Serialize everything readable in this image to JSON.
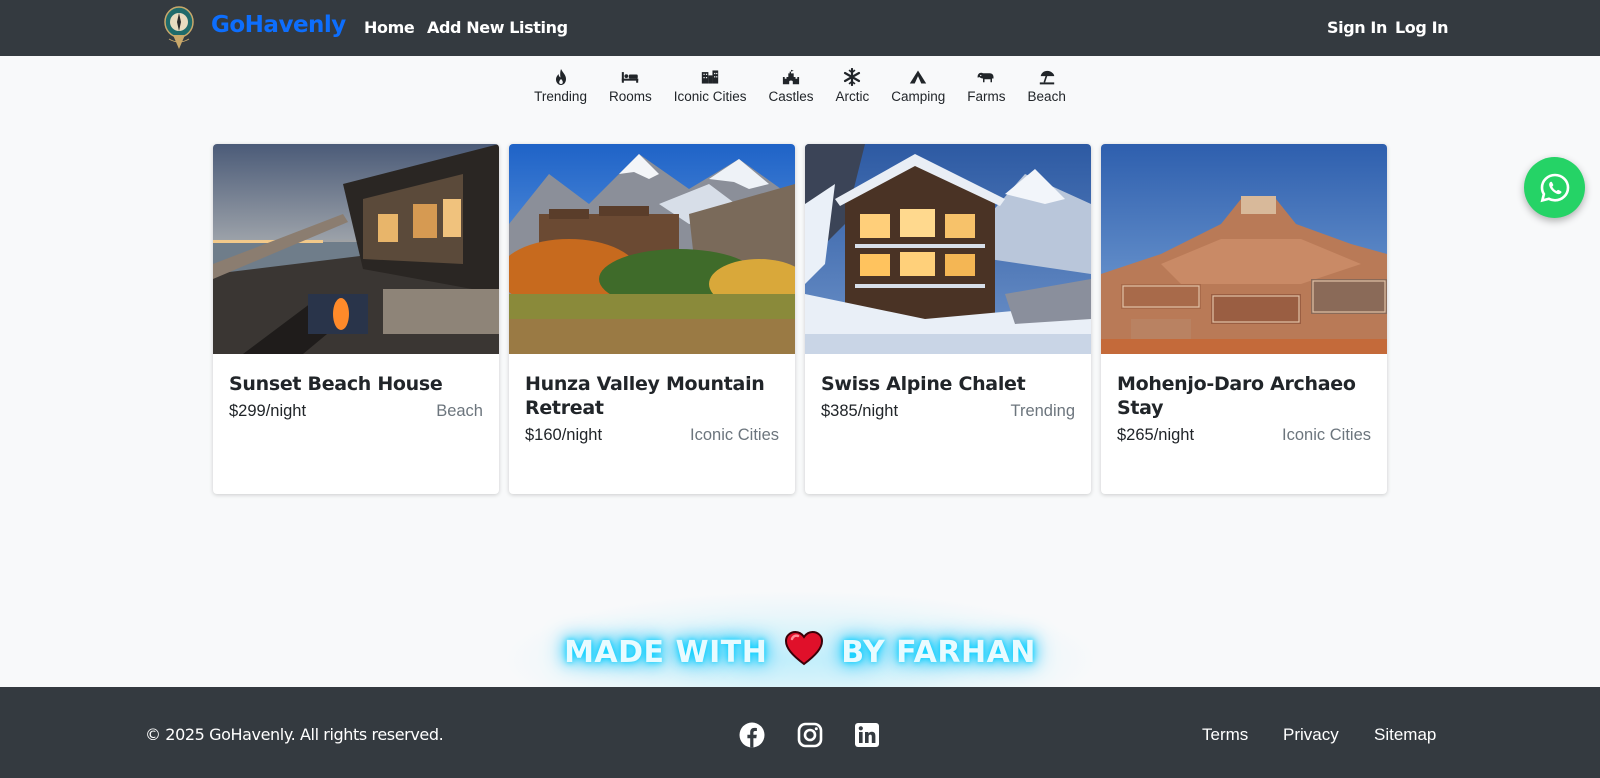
{
  "navbar": {
    "brand": "GoHavenly",
    "links": {
      "home": "Home",
      "add_listing": "Add New Listing",
      "sign_in": "Sign In",
      "log_in": "Log In"
    },
    "logo_icon": "compass-pin-logo",
    "colors": {
      "background": "#343a40",
      "brand": "#0d6efd"
    }
  },
  "filters": [
    {
      "label": "Trending",
      "icon": "fire-icon"
    },
    {
      "label": "Rooms",
      "icon": "bed-icon"
    },
    {
      "label": "Iconic Cities",
      "icon": "city-icon"
    },
    {
      "label": "Castles",
      "icon": "castle-icon"
    },
    {
      "label": "Arctic",
      "icon": "snowflake-icon"
    },
    {
      "label": "Camping",
      "icon": "tent-icon"
    },
    {
      "label": "Farms",
      "icon": "cow-icon"
    },
    {
      "label": "Beach",
      "icon": "umbrella-beach-icon"
    }
  ],
  "listings": [
    {
      "title": "Sunset Beach House",
      "price": "$299/night",
      "category": "Beach"
    },
    {
      "title": "Hunza Valley Mountain Retreat",
      "price": "$160/night",
      "category": "Iconic Cities"
    },
    {
      "title": "Swiss Alpine Chalet",
      "price": "$385/night",
      "category": "Trending"
    },
    {
      "title": "Mohenjo-Daro Archaeo Stay",
      "price": "$265/night",
      "category": "Iconic Cities"
    }
  ],
  "whatsapp": {
    "icon": "whatsapp-icon",
    "color": "#25d366"
  },
  "banner": {
    "before": "MADE WITH",
    "after": "BY FARHAN",
    "icon": "heart-icon",
    "glow_color": "#00cfff"
  },
  "footer": {
    "copyright": "© 2025 GoHavenly. All rights reserved.",
    "social": [
      "facebook-icon",
      "instagram-icon",
      "linkedin-icon"
    ],
    "links": {
      "terms": "Terms",
      "privacy": "Privacy",
      "sitemap": "Sitemap"
    }
  }
}
